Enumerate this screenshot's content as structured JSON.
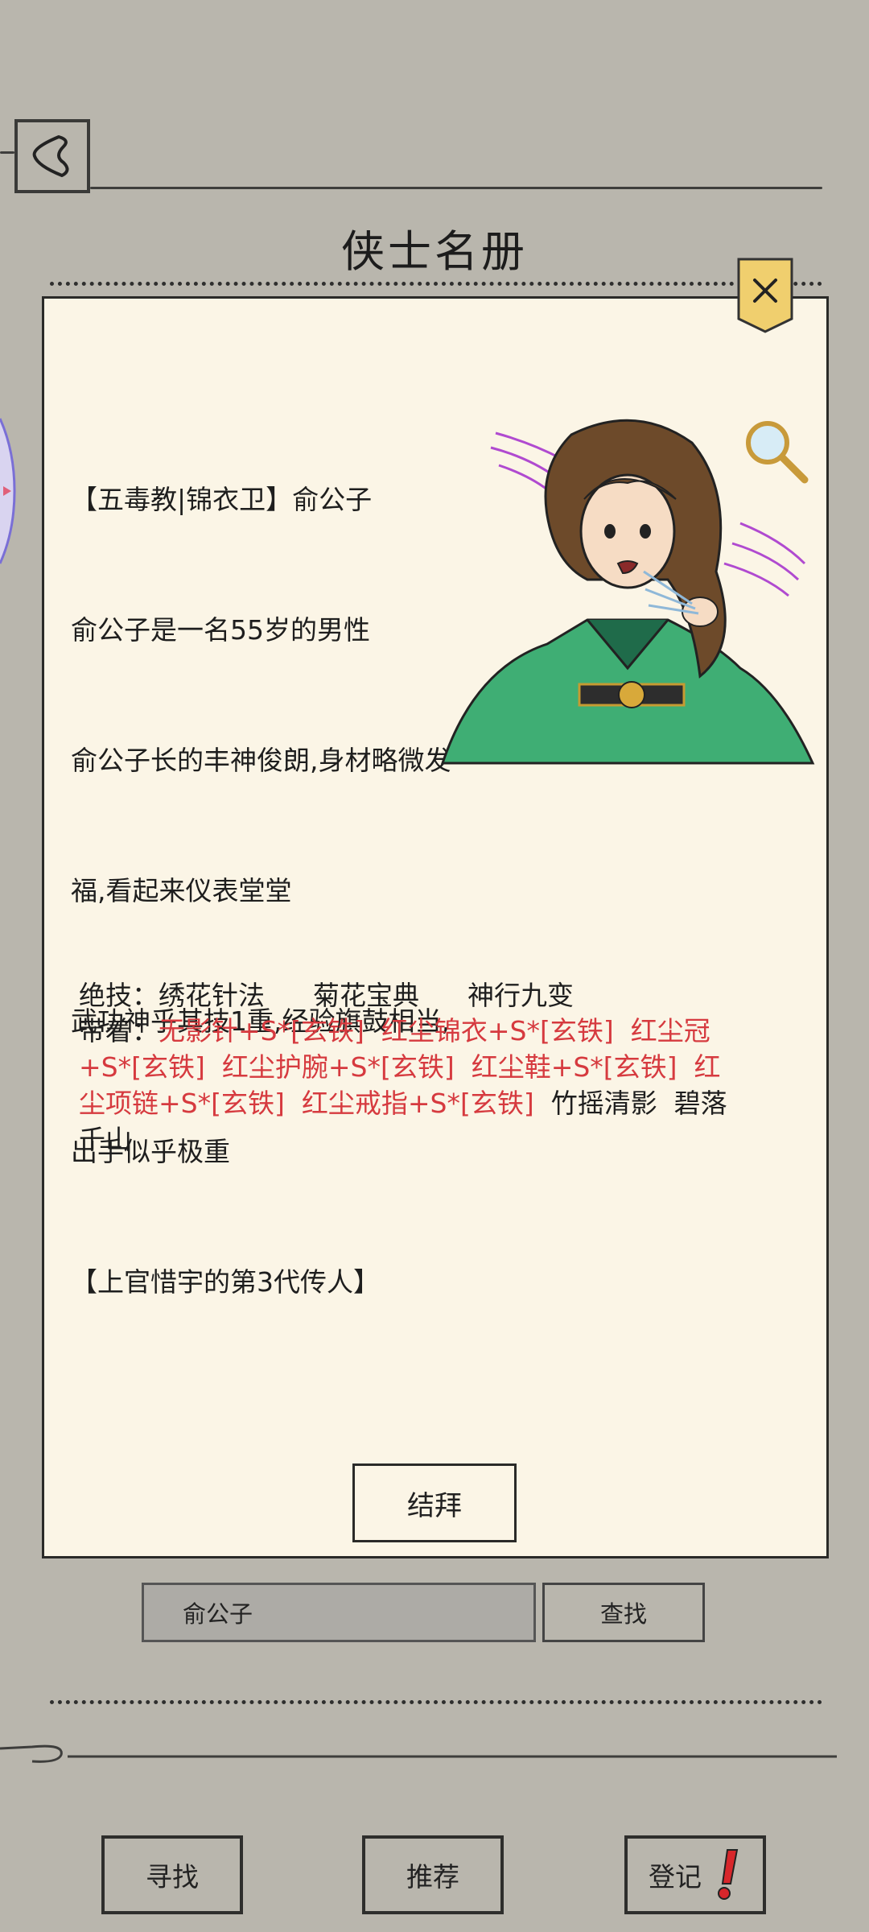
{
  "header": {
    "title": "侠士名册"
  },
  "profile": {
    "bio_lines": [
      "【五毒教|锦衣卫】俞公子",
      "俞公子是一名55岁的男性",
      "俞公子长的丰神俊朗,身材略微发",
      "福,看起来仪表堂堂",
      "武功神乎其技1重,经验旗鼓相当,",
      "出手似乎极重",
      "【上官惜宇的第3代传人】"
    ],
    "skills_label": "绝技：",
    "skills": [
      "绣花针法",
      "菊花宝典",
      "神行九变"
    ],
    "gear_label": "带着：",
    "gear_red": [
      "无影针+S*[玄铁]",
      "红尘锦衣+S*[玄铁]",
      "红尘冠+S*[玄铁]",
      "红尘护腕+S*[玄铁]",
      "红尘鞋+S*[玄铁]",
      "红尘项链+S*[玄铁]",
      "红尘戒指+S*[玄铁]"
    ],
    "gear_plain": [
      "竹摇清影",
      "碧落千山"
    ],
    "bond_button": "结拜"
  },
  "search": {
    "value": "俞公子",
    "button": "查找"
  },
  "bottom_nav": {
    "seek": "寻找",
    "recommend": "推荐",
    "register": "登记"
  },
  "colors": {
    "background": "#b9b6ad",
    "panel": "#fbf5e6",
    "equip_red": "#d63a3f",
    "alert_red": "#d8262b"
  },
  "icons": {
    "back": "back-arrow-icon",
    "close": "close-icon",
    "magnifier": "magnifier-icon",
    "alert": "exclamation-icon"
  }
}
